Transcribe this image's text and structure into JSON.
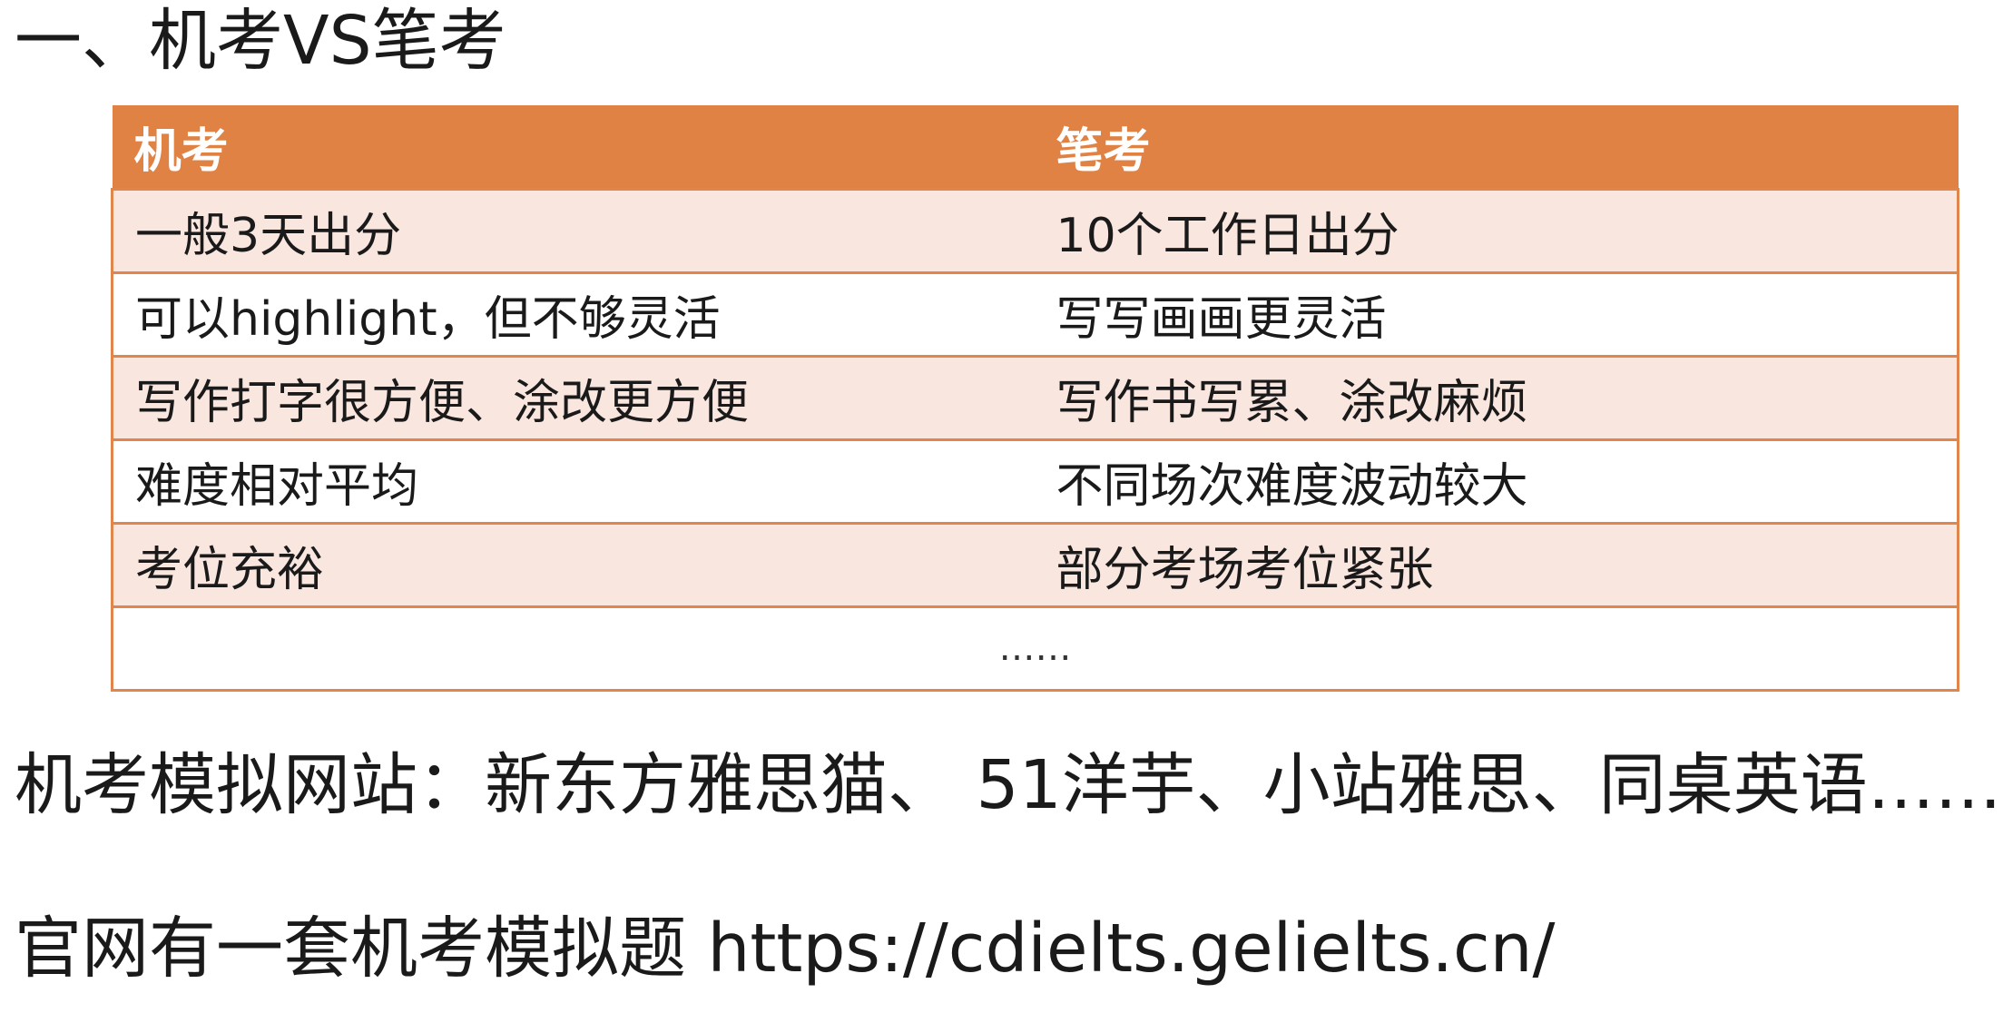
{
  "heading": "一、机考VS笔考",
  "table": {
    "headers": [
      "机考",
      "笔考"
    ],
    "rows": [
      [
        "一般3天出分",
        "10个工作日出分"
      ],
      [
        "可以highlight，但不够灵活",
        "写写画画更灵活"
      ],
      [
        "写作打字很方便、涂改更方便",
        "写作书写累、涂改麻烦"
      ],
      [
        "难度相对平均",
        "不同场次难度波动较大"
      ],
      [
        "考位充裕",
        "部分考场考位紧张"
      ]
    ],
    "ellipsis": "……"
  },
  "sites_line": "机考模拟网站：新东方雅思猫、 51洋芋、小站雅思、同桌英语……",
  "official_line": "官网有一套机考模拟题 https://cdielts.gelielts.cn/"
}
